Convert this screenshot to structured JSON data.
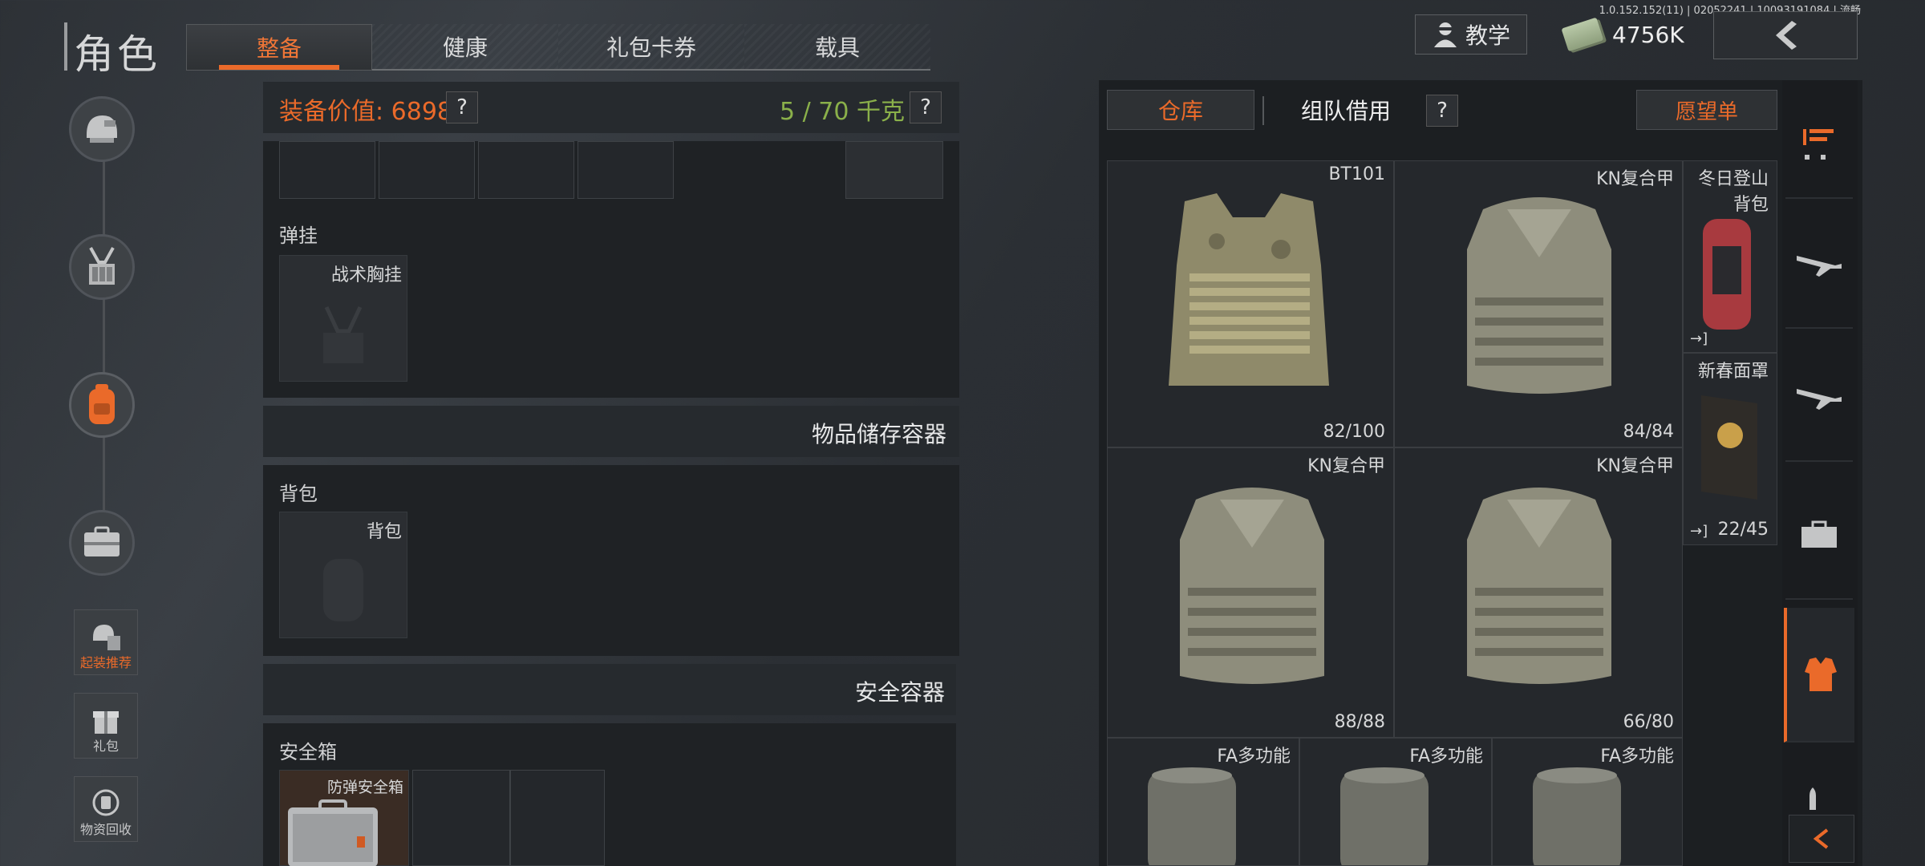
{
  "version_text": "1.0.152.152(11) | 02052241 | 10093191084 | 流畅",
  "header": {
    "title": "角色",
    "tabs": [
      {
        "label": "整备",
        "active": true
      },
      {
        "label": "健康",
        "active": false
      },
      {
        "label": "礼包卡券",
        "active": false
      },
      {
        "label": "载具",
        "active": false
      }
    ],
    "tutorial_label": "教学",
    "currency": "4756K"
  },
  "left_rail": {
    "items": [
      {
        "label": "起装推荐",
        "highlight": true
      },
      {
        "label": "礼包",
        "highlight": false
      },
      {
        "label": "物资回收",
        "highlight": false
      }
    ]
  },
  "loadout": {
    "equip_value": "装备价值: 6898",
    "help": "?",
    "weight": "5 / 70 千克",
    "sections": {
      "rig_label": "弹挂",
      "rig_slot": "战术胸挂",
      "storage_title": "物品储存容器",
      "backpack_label": "背包",
      "backpack_slot": "背包",
      "safe_title": "安全容器",
      "safebox_label": "安全箱",
      "safebox_item": "防弹安全箱"
    }
  },
  "stash": {
    "tabs": {
      "warehouse": "仓库",
      "team_borrow": "组队借用",
      "help": "?",
      "wishlist": "愿望单"
    },
    "items": [
      {
        "name": "BT101",
        "durability": "82/100"
      },
      {
        "name": "KN复合甲",
        "durability": "84/84"
      },
      {
        "name": "冬日登山背包",
        "durability": ""
      },
      {
        "name": "新春面罩",
        "durability": "22/45"
      },
      {
        "name": "KN复合甲",
        "durability": "88/88"
      },
      {
        "name": "KN复合甲",
        "durability": "66/80"
      },
      {
        "name": "FA多功能",
        "durability": ""
      },
      {
        "name": "FA多功能",
        "durability": ""
      },
      {
        "name": "FA多功能",
        "durability": ""
      }
    ]
  },
  "colors": {
    "accent": "#ea6a2a",
    "weight_green": "#8ab04a"
  }
}
